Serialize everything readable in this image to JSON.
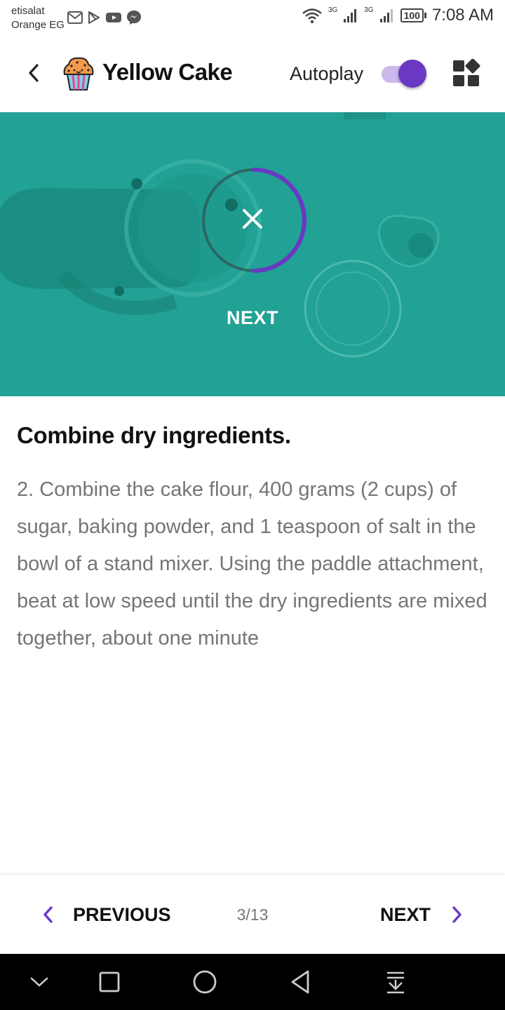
{
  "status_bar": {
    "carrier_line1": "etisalat",
    "carrier_line2": "Orange EG",
    "network_1": "3G",
    "network_2": "3G",
    "battery": "100",
    "time": "7:08 AM",
    "left_icons": [
      "gmail-icon",
      "play-store-icon",
      "youtube-icon",
      "messenger-icon"
    ],
    "right_icons": [
      "wifi-icon",
      "signal-icon",
      "signal-icon",
      "battery-icon"
    ]
  },
  "app_bar": {
    "title": "Yellow Cake",
    "autoplay_label": "Autoplay",
    "autoplay_on": true,
    "icons": [
      "back-arrow-icon",
      "cupcake-icon",
      "grid-view-icon"
    ]
  },
  "hero": {
    "next_label": "NEXT",
    "timer_progress": 0.5,
    "icons": [
      "close-icon"
    ]
  },
  "step": {
    "title": "Combine dry ingredients.",
    "text": "2. Combine the cake flour, 400 grams (2 cups) of sugar, baking powder, and 1 teaspoon of salt in the bowl of a stand mixer. Using the paddle attachment, beat at low speed until the dry ingredients are mixed together, about one minute"
  },
  "bottom_nav": {
    "previous_label": "PREVIOUS",
    "page_indicator": "3/13",
    "next_label": "NEXT"
  },
  "colors": {
    "accent": "#6a38c2",
    "hero_bg": "#22a195",
    "body_text": "#757575"
  },
  "system_nav": {
    "icons": [
      "chevron-down-icon",
      "recents-icon",
      "home-icon",
      "back-icon",
      "notification-pull-icon"
    ]
  }
}
